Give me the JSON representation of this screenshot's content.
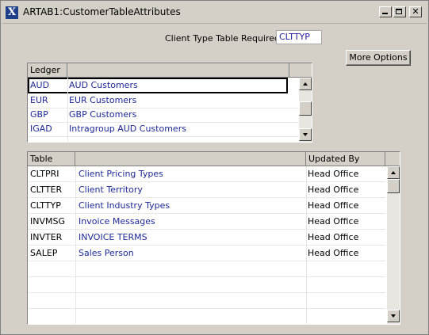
{
  "window": {
    "title": "ARTAB1:CustomerTableAttributes"
  },
  "header": {
    "client_type_label": "Client Type Table Required:",
    "client_type_value": "CLTTYP"
  },
  "toolbar": {
    "more_options_label": "More Options"
  },
  "ledger_grid": {
    "columns": [
      "Ledger",
      ""
    ],
    "rows": [
      {
        "code": "AUD",
        "description": "AUD Customers"
      },
      {
        "code": "EUR",
        "description": "EUR Customers"
      },
      {
        "code": "GBP",
        "description": "GBP Customers"
      },
      {
        "code": "IGAD",
        "description": "Intragroup AUD Customers"
      }
    ]
  },
  "table_grid": {
    "columns": [
      "Table",
      "",
      "Updated By"
    ],
    "rows": [
      {
        "table": "CLTPRI",
        "description": "Client Pricing Types",
        "updated_by": "Head Office"
      },
      {
        "table": "CLTTER",
        "description": "Client Territory",
        "updated_by": "Head Office"
      },
      {
        "table": "CLTTYP",
        "description": "Client Industry Types",
        "updated_by": "Head Office"
      },
      {
        "table": "INVMSG",
        "description": "Invoice Messages",
        "updated_by": "Head Office"
      },
      {
        "table": "INVTER",
        "description": "INVOICE TERMS",
        "updated_by": "Head Office"
      },
      {
        "table": "SALEP",
        "description": "Sales Person",
        "updated_by": "Head Office"
      }
    ]
  },
  "colors": {
    "text_blue": "#1e2a98",
    "window_bg": "#d4d0c8"
  }
}
